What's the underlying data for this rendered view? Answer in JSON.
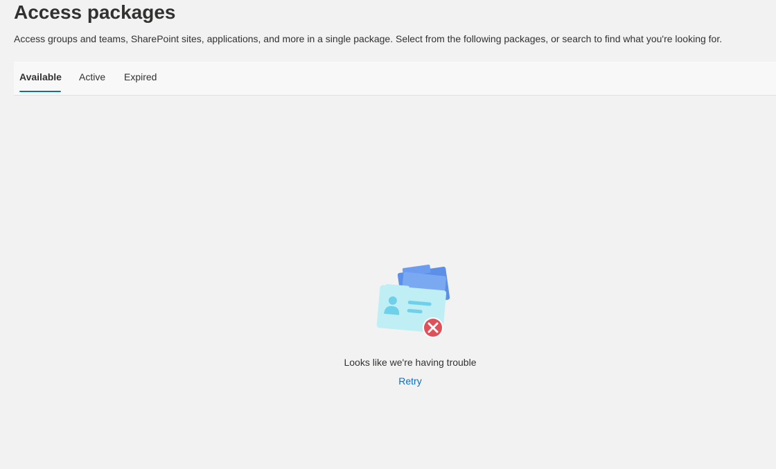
{
  "header": {
    "title": "Access packages",
    "description": "Access groups and teams, SharePoint sites, applications, and more in a single package. Select from the following packages, or search to find what you're looking for."
  },
  "tabs": [
    {
      "label": "Available",
      "selected": true
    },
    {
      "label": "Active",
      "selected": false
    },
    {
      "label": "Expired",
      "selected": false
    }
  ],
  "error_state": {
    "illustration_icon": "id-card-error-icon",
    "message": "Looks like we're having trouble",
    "retry_label": "Retry"
  },
  "colors": {
    "background": "#f2f2f2",
    "accent": "#0f6cbd",
    "error": "#e0505a",
    "text": "#323130"
  }
}
